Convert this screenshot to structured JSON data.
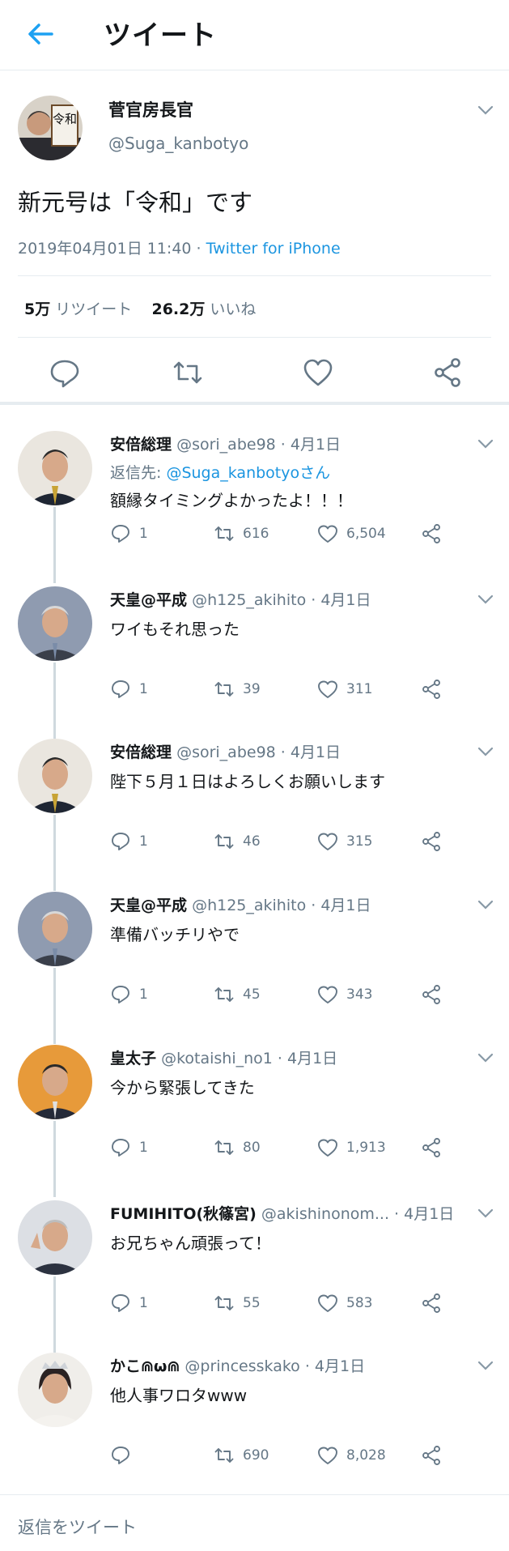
{
  "header": {
    "title": "ツイート"
  },
  "main_tweet": {
    "name": "菅官房長官",
    "handle": "@Suga_kanbotyo",
    "text": "新元号は「令和」です",
    "timestamp": "2019年04月01日 11:40 · ",
    "source": "Twitter for iPhone",
    "retweet_count": "5万",
    "retweet_label": "リツイート",
    "like_count": "26.2万",
    "like_label": "いいね",
    "placard": "令和"
  },
  "replies": [
    {
      "name": "安倍総理",
      "handle": "@sori_abe98",
      "date": " · 4月1日",
      "reply_prefix": "返信先: ",
      "reply_to": "@Suga_kanbotyo",
      "reply_suffix": "さん",
      "text": "額縁タイミングよかったよ！！！",
      "replies": "1",
      "retweets": "616",
      "likes": "6,504",
      "avatar": "abe"
    },
    {
      "name": "天皇@平成",
      "handle": "@h125_akihito",
      "date": " · 4月1日",
      "text": "ワイもそれ思った",
      "replies": "1",
      "retweets": "39",
      "likes": "311",
      "avatar": "akihito"
    },
    {
      "name": "安倍総理",
      "handle": "@sori_abe98",
      "date": " · 4月1日",
      "text": "陛下５月１日はよろしくお願いします",
      "replies": "1",
      "retweets": "46",
      "likes": "315",
      "avatar": "abe"
    },
    {
      "name": "天皇@平成",
      "handle": "@h125_akihito",
      "date": " · 4月1日",
      "text": "準備バッチリやで",
      "replies": "1",
      "retweets": "45",
      "likes": "343",
      "avatar": "akihito"
    },
    {
      "name": "皇太子",
      "handle": "@kotaishi_no1",
      "date": " · 4月1日",
      "text": "今から緊張してきた",
      "replies": "1",
      "retweets": "80",
      "likes": "1,913",
      "avatar": "naruhito"
    },
    {
      "name": "FUMIHITO(秋篠宮)",
      "handle": "@akishinonom...",
      "date": " · 4月1日",
      "text": "お兄ちゃん頑張って！",
      "replies": "1",
      "retweets": "55",
      "likes": "583",
      "avatar": "fumihito"
    },
    {
      "name": "かこ⋒ω⋒",
      "handle": "@princesskako",
      "date": " · 4月1日",
      "text": "他人事ワロタwww",
      "replies": "",
      "retweets": "690",
      "likes": "8,028",
      "avatar": "kako"
    }
  ],
  "footer": {
    "placeholder": "返信をツイート"
  },
  "colors": {
    "accent": "#1da1f2",
    "link": "#1b95e0",
    "muted": "#657786",
    "divider": "#e6ecf0"
  }
}
